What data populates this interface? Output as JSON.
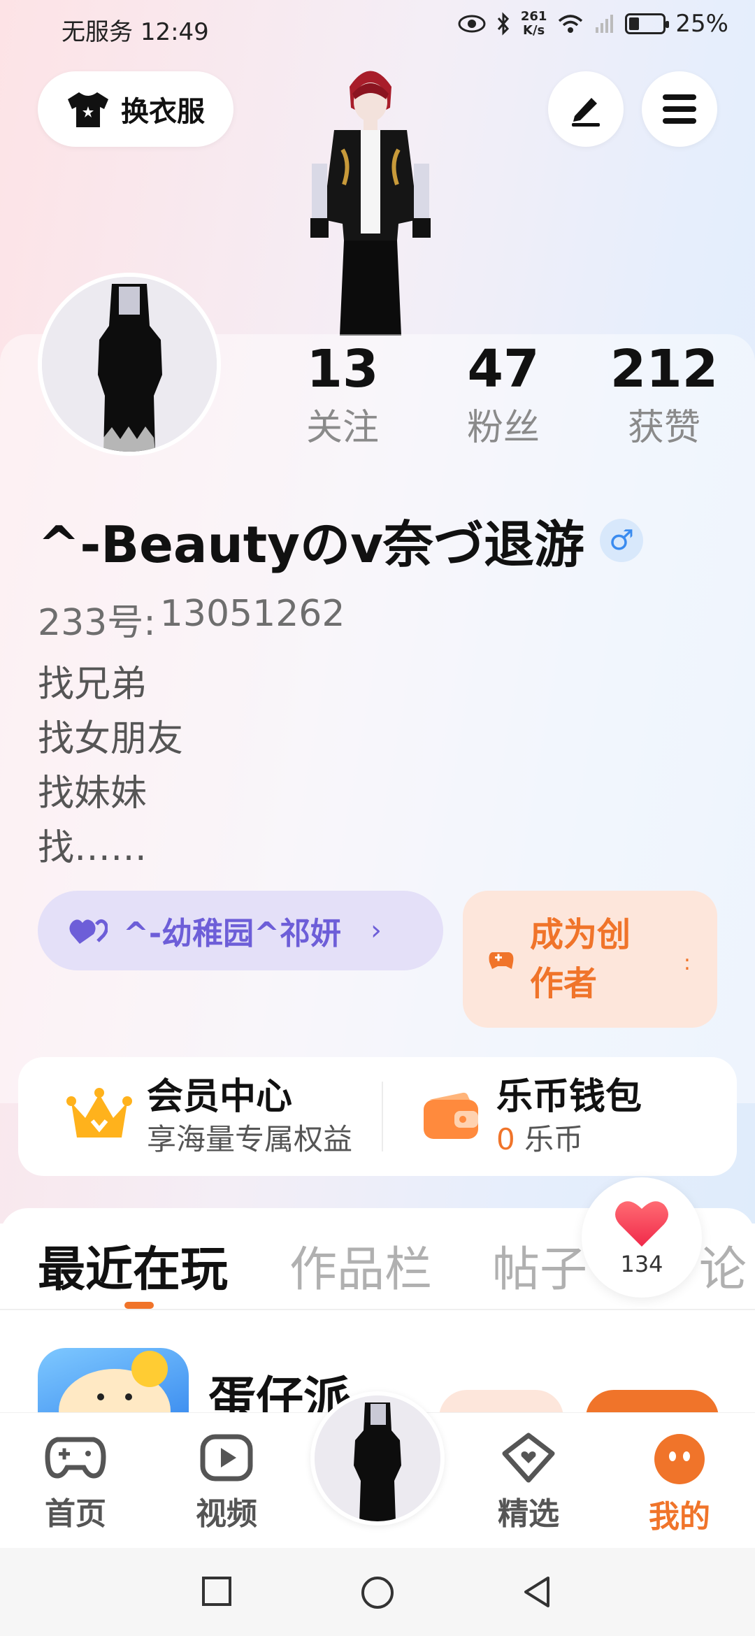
{
  "status_bar": {
    "carrier": "无服务",
    "time": "12:49",
    "net_speed_value": "261",
    "net_speed_unit": "K/s",
    "battery_percent": "25%"
  },
  "top": {
    "dress_label": "换衣服"
  },
  "stats": [
    {
      "num": "13",
      "label": "关注"
    },
    {
      "num": "47",
      "label": "粉丝"
    },
    {
      "num": "212",
      "label": "获赞"
    }
  ],
  "profile": {
    "nickname": "^-Beautyのv奈づ退游",
    "gender_symbol": "♂",
    "uid_label": "233号:",
    "uid_value": "13051262",
    "bio": [
      "找兄弟",
      "找女朋友",
      "找妹妹",
      "找……"
    ]
  },
  "guild": {
    "label": "^-幼稚园^祁妍",
    "chevron": "›"
  },
  "creator": {
    "label": "成为创作者"
  },
  "member": {
    "title": "会员中心",
    "sub": "享海量专属权益"
  },
  "wallet": {
    "title": "乐币钱包",
    "coin_value": "0",
    "coin_unit": "乐币"
  },
  "tabs": [
    "最近在玩",
    "作品栏",
    "帖子",
    "论"
  ],
  "like_count": "134",
  "recent_game": {
    "name": "蛋仔派"
  },
  "bottom_nav": [
    {
      "label": "首页",
      "icon": "gamepad-icon"
    },
    {
      "label": "视频",
      "icon": "play-icon"
    },
    {
      "label": "精选",
      "icon": "heart-badge-icon"
    },
    {
      "label": "我的",
      "icon": "face-icon"
    }
  ],
  "colors": {
    "accent": "#f0742a",
    "guild": "#6d5ed8",
    "gender": "#3a8bef"
  }
}
